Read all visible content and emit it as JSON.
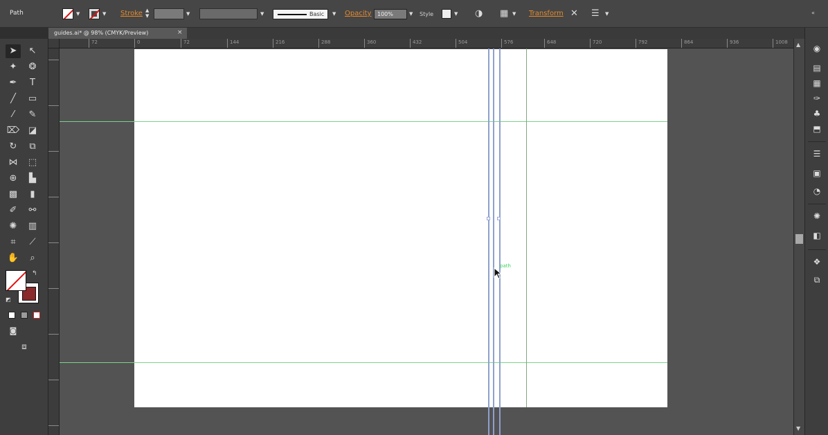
{
  "control_bar": {
    "selection_type": "Path",
    "stroke_label": "Stroke",
    "brush_label": "Basic",
    "opacity_label": "Opacity",
    "opacity_value": "100%",
    "style_label": "Style",
    "transform_label": "Transform"
  },
  "document": {
    "tab_title": "guides.ai* @ 98% (CMYK/Preview)"
  },
  "ruler": {
    "labels": [
      "72",
      "0",
      "72",
      "144",
      "216",
      "288",
      "360",
      "432",
      "504",
      "576",
      "648",
      "720",
      "792",
      "864",
      "936",
      "1008"
    ]
  },
  "canvas": {
    "smart_guide_text": "path"
  },
  "colors": {
    "accent": "#e58a2c",
    "guide": "#7bd38a",
    "path": "#8fa0cf",
    "artboard": "#ffffff",
    "pasteboard": "#535353"
  },
  "icons": {
    "close": "close-icon",
    "collapse": "collapse-panel-icon"
  }
}
